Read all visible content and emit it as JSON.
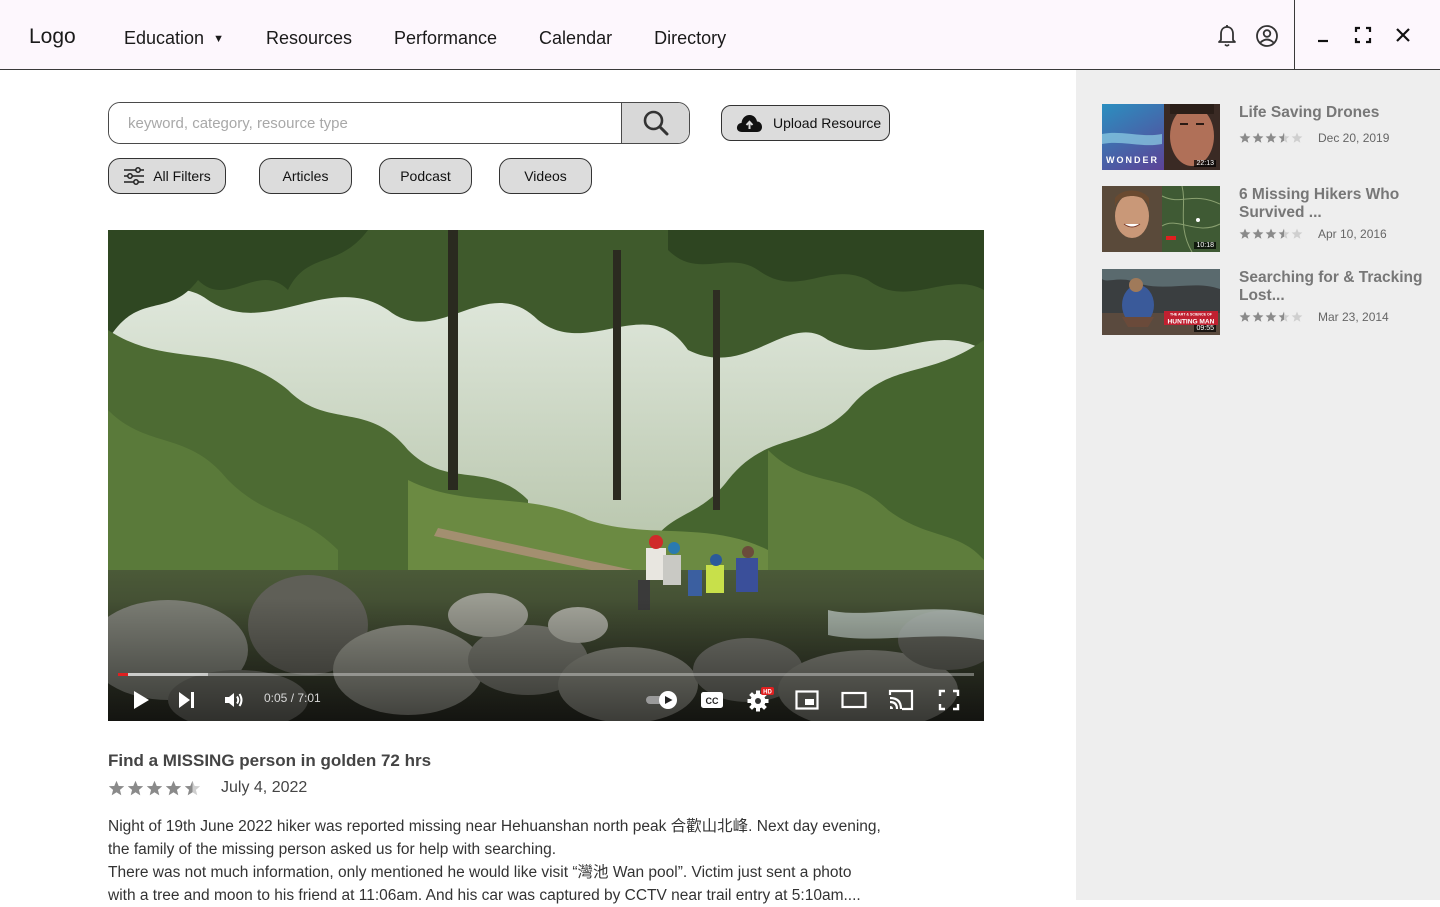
{
  "app": {
    "logo": "Logo",
    "nav": [
      {
        "label": "Education",
        "has_dropdown": true
      },
      {
        "label": "Resources"
      },
      {
        "label": "Performance"
      },
      {
        "label": "Calendar"
      },
      {
        "label": "Directory"
      }
    ],
    "dropdown_caret": "▼",
    "icons": [
      "bell-icon",
      "account-circle-icon",
      "minimize-icon",
      "maximize-icon",
      "close-icon"
    ]
  },
  "search": {
    "placeholder": "keyword, category, resource type",
    "value": ""
  },
  "upload": {
    "label": "Upload Resource",
    "icon": "cloud-upload-icon"
  },
  "filters": [
    {
      "label": "All Filters",
      "icon": "sliders-icon"
    },
    {
      "label": "Articles"
    },
    {
      "label": "Podcast"
    },
    {
      "label": "Videos"
    }
  ],
  "player": {
    "current_time": "0:05",
    "duration": "7:01",
    "time_display": "0:05 / 7:01",
    "played_fraction": 0.012,
    "buffered_fraction": 0.105,
    "settings_badge": "HD",
    "controls": [
      "play-icon",
      "next-icon",
      "volume-icon",
      "autoplay-toggle-icon",
      "captions-icon",
      "settings-icon",
      "miniplayer-icon",
      "theater-mode-icon",
      "cast-icon",
      "fullscreen-icon"
    ],
    "captions_label": "CC"
  },
  "video": {
    "title": "Find a MISSING person in golden 72 hrs",
    "rating": 4.5,
    "date": "July 4, 2022",
    "description": [
      "Night of 19th June 2022 hiker was reported missing near Hehuanshan north peak 合歡山北峰. Next day evening,",
      "the family of the missing person asked us for help with searching.",
      "There was not much information, only mentioned he would like visit “灣池 Wan pool”. Victim just sent a photo",
      "with a tree and moon to his friend at 11:06am. And his car was captured by CCTV near trail entry at 5:10am...."
    ]
  },
  "related": [
    {
      "title": "Life Saving Drones",
      "rating": 3.5,
      "date": "Dec 20, 2019",
      "duration": "22:13",
      "thumb_text": "WONDER"
    },
    {
      "title": "6 Missing Hikers Who Survived ...",
      "rating": 3.5,
      "date": "Apr 10, 2016",
      "duration": "10:18",
      "thumb_text": ""
    },
    {
      "title": "Searching for & Tracking Lost...",
      "rating": 3.5,
      "date": "Mar 23, 2014",
      "duration": "09:55",
      "thumb_text": "HUNTING MAN",
      "thumb_subtext": "THE ART & SCIENCE OF"
    }
  ],
  "colors": {
    "topbar_bg": "#fdf7fd",
    "sidebar_bg": "#eeeeee",
    "chip_bg": "#dcdcdc",
    "progress_red": "#e02020",
    "star_gray": "#8a8a8a"
  }
}
